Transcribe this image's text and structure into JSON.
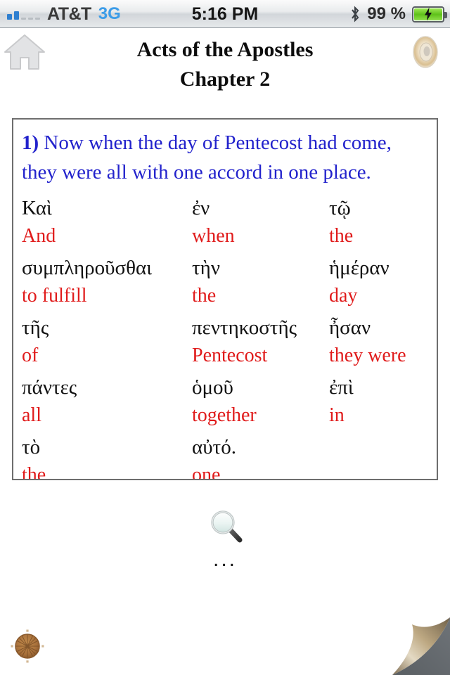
{
  "status_bar": {
    "carrier": "AT&T",
    "network": "3G",
    "time": "5:16 PM",
    "battery_percent": "99 %",
    "bluetooth_icon": "bluetooth-icon",
    "battery_icon": "battery-charging-icon",
    "signal_icon": "signal-bars-icon"
  },
  "header": {
    "home_icon": "home-icon",
    "audio_icon": "speaker-icon",
    "title": "Acts of the Apostles",
    "subtitle": "Chapter 2"
  },
  "verse": {
    "number": "1)",
    "translation": "Now when the day of Pentecost had come, they were all with one accord in one place.",
    "translation_color": "#2222cc",
    "greek_color": "#111111",
    "gloss_color": "#e01b1b",
    "rows": [
      [
        {
          "greek": "Καὶ",
          "gloss": "And"
        },
        {
          "greek": "ἐν",
          "gloss": "when"
        },
        {
          "greek": "τῷ",
          "gloss": "the"
        }
      ],
      [
        {
          "greek": "συμπληροῦσθαι",
          "gloss": "to fulfill"
        },
        {
          "greek": "τὴν",
          "gloss": "the"
        },
        {
          "greek": "ἡμέραν",
          "gloss": "day"
        }
      ],
      [
        {
          "greek": "τῆς",
          "gloss": "of"
        },
        {
          "greek": "πεντηκοστῆς",
          "gloss": "Pentecost"
        },
        {
          "greek": "ἦσαν",
          "gloss": "they were"
        }
      ],
      [
        {
          "greek": "πάντες",
          "gloss": "all"
        },
        {
          "greek": "ὁμοῦ",
          "gloss": "together"
        },
        {
          "greek": "ἐπὶ",
          "gloss": "in"
        }
      ],
      [
        {
          "greek": "τὸ",
          "gloss": "the"
        },
        {
          "greek": "αὐτό.",
          "gloss": "one"
        },
        {
          "greek": "",
          "gloss": ""
        }
      ]
    ]
  },
  "controls": {
    "search_icon": "magnifier-icon",
    "more_label": "...",
    "compass_icon": "compass-icon",
    "page_curl_icon": "page-curl-icon"
  }
}
